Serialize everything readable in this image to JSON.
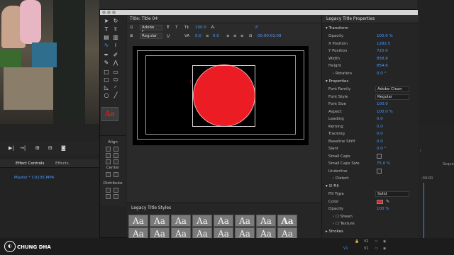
{
  "watermark": {
    "text": "CHUNG DHA"
  },
  "title_window": {
    "tab_label": "Title: Title 04",
    "font_family_short": "Adobe C...",
    "font_style": "Regular",
    "size_value": "100.0",
    "kern_value": "0.0",
    "lead_value": "0.0",
    "timecode": "00:00:01:09"
  },
  "align_panel": {
    "align_label": "Align",
    "center_label": "Center",
    "distribute_label": "Distribute"
  },
  "styles_panel": {
    "title": "Legacy Title Styles",
    "swatches": [
      "Aa",
      "Aa",
      "Aa",
      "Aa",
      "Aa",
      "Aa",
      "Aa",
      "Aa",
      "Aa",
      "Aa",
      "Aa",
      "Aa",
      "Aa",
      "Aa",
      "Aa",
      "Aa"
    ]
  },
  "properties": {
    "title": "Legacy Title Properties",
    "transform_label": "Transform",
    "opacity_label": "Opacity",
    "opacity": "100.0 %",
    "xpos_label": "X Position",
    "xpos": "1282.5",
    "ypos_label": "Y Position",
    "ypos": "720.0",
    "width_label": "Width",
    "width": "858.8",
    "height_label": "Height",
    "height": "854.6",
    "rotation_label": "Rotation",
    "rotation": "0.0 °",
    "properties_label": "Properties",
    "font_family_label": "Font Family",
    "font_family": "Adobe Clean",
    "font_style_label": "Font Style",
    "font_style": "Regular",
    "font_size_label": "Font Size",
    "font_size": "100.0",
    "aspect_label": "Aspect",
    "aspect": "100.0 %",
    "leading_label": "Leading",
    "leading": "0.0",
    "kerning_label": "Kerning",
    "kerning": "0.0",
    "tracking_label": "Tracking",
    "tracking": "0.0",
    "baseline_label": "Baseline Shift",
    "baseline": "0.0",
    "slant_label": "Slant",
    "slant": "0.0 °",
    "smallcaps_label": "Small Caps",
    "smallcaps_size_label": "Small Caps Size",
    "smallcaps_size": "75.0 %",
    "underline_label": "Underline",
    "distort_label": "Distort",
    "fill_label": "Fill",
    "fill_type_label": "Fill Type",
    "fill_type": "Solid",
    "color_label": "Color",
    "fill_opacity_label": "Opacity",
    "fill_opacity": "100 %",
    "sheen_label": "Sheen",
    "texture_label": "Texture",
    "strokes_label": "Strokes"
  },
  "left_panel": {
    "effect_controls_tab": "Effect Controls",
    "effects_tab": "Effects",
    "source_label": "Master * C0135.MP4"
  },
  "timeline": {
    "time_label": ":00:00",
    "seq_label": "Seque",
    "track_v2": "V2",
    "track_v1": "V1"
  },
  "colors": {
    "accent_blue": "#4a9bff",
    "fill_red": "#ec1c24"
  }
}
